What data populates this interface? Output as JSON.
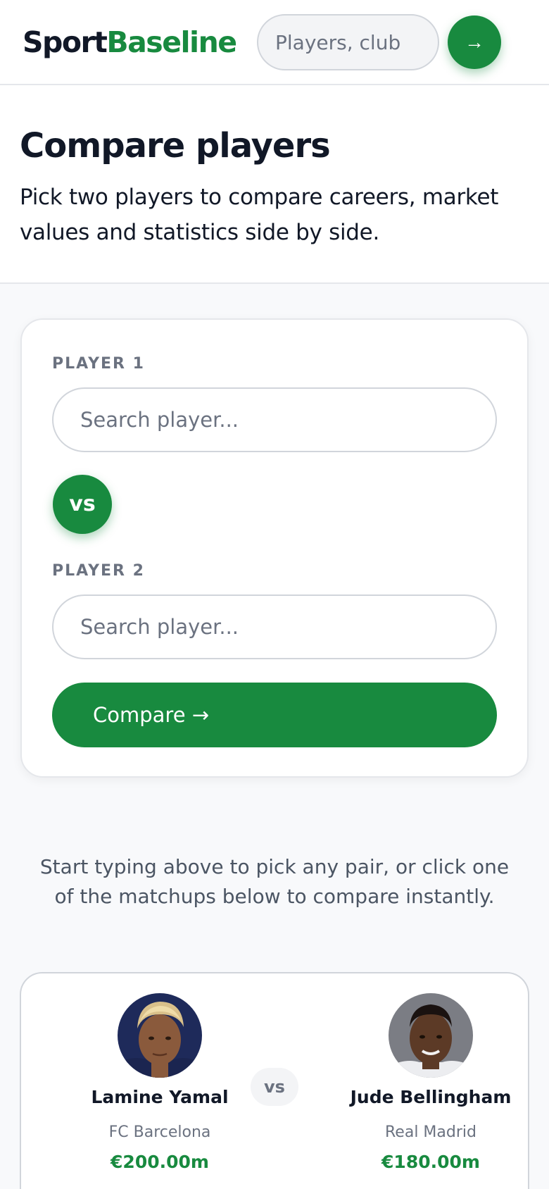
{
  "brand": {
    "part1": "Sport",
    "part2": "Baseline",
    "accent_color": "#188a3f"
  },
  "header": {
    "search_placeholder": "Players, club",
    "search_go_icon": "→"
  },
  "intro": {
    "title": "Compare players",
    "subtitle": "Pick two players to compare careers, market values and statistics side by side."
  },
  "compare": {
    "player1_label": "PLAYER 1",
    "player1_placeholder": "Search player...",
    "vs_label": "vs",
    "player2_label": "PLAYER 2",
    "player2_placeholder": "Search player...",
    "button_label": "Compare →"
  },
  "hint": "Start typing above to pick any pair, or click one of the matchups below to compare instantly.",
  "matchups": [
    {
      "vs_label": "vs",
      "left": {
        "name": "Lamine Yamal",
        "club": "FC Barcelona",
        "value": "€200.00m"
      },
      "right": {
        "name": "Jude Bellingham",
        "club": "Real Madrid",
        "value": "€180.00m"
      }
    }
  ]
}
